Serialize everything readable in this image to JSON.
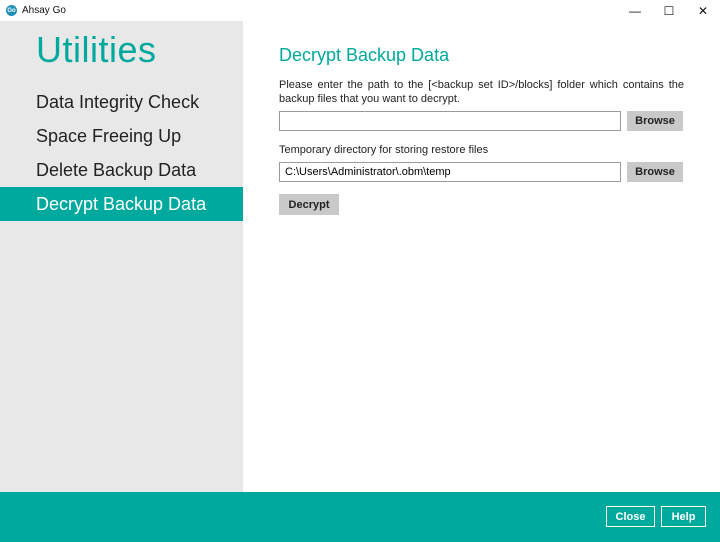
{
  "window": {
    "app_icon_text": "Go",
    "title": "Ahsay Go",
    "minimize": "—",
    "maximize": "☐",
    "close": "✕"
  },
  "sidebar": {
    "title": "Utilities",
    "items": [
      {
        "label": "Data Integrity Check",
        "active": false
      },
      {
        "label": "Space Freeing Up",
        "active": false
      },
      {
        "label": "Delete Backup Data",
        "active": false
      },
      {
        "label": "Decrypt Backup Data",
        "active": true
      }
    ]
  },
  "main": {
    "title": "Decrypt Backup Data",
    "description": "Please enter the path to the [<backup set ID>/blocks] folder which contains the backup files that you want to decrypt.",
    "path_input": {
      "value": "",
      "placeholder": ""
    },
    "browse_label": "Browse",
    "temp_label": "Temporary directory for storing restore files",
    "temp_input": {
      "value": "C:\\Users\\Administrator\\.obm\\temp"
    },
    "decrypt_label": "Decrypt"
  },
  "footer": {
    "close_label": "Close",
    "help_label": "Help"
  },
  "colors": {
    "accent": "#00a99d",
    "sidebar_bg": "#e8e8e8",
    "button_bg": "#c9c9c9"
  }
}
